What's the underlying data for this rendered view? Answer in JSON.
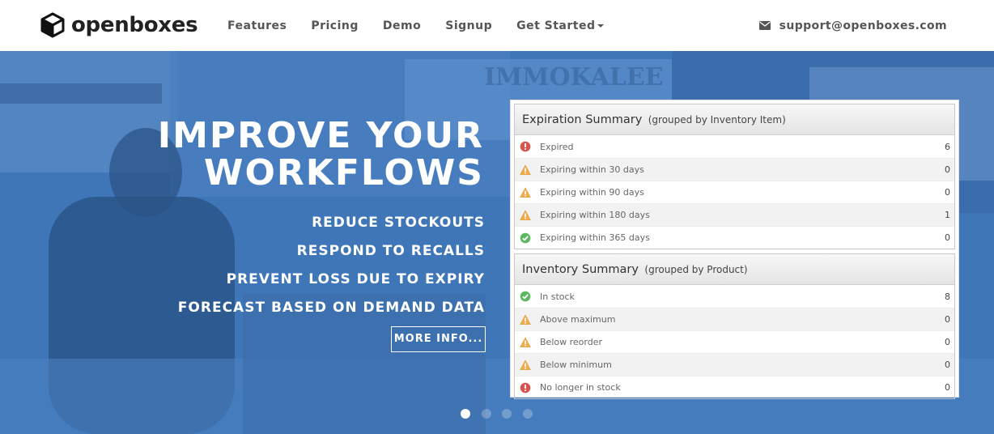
{
  "brand": {
    "name": "openboxes",
    "logo_icon": "cube-icon"
  },
  "nav": {
    "links": [
      "Features",
      "Pricing",
      "Demo",
      "Signup"
    ],
    "dropdown_label": "Get Started",
    "email": "support@openboxes.com",
    "email_icon": "envelope-icon"
  },
  "hero": {
    "headline_line1": "IMPROVE YOUR",
    "headline_line2": "WORKFLOWS",
    "bullets": [
      "REDUCE STOCKOUTS",
      "RESPOND TO RECALLS",
      "PREVENT LOSS DUE TO EXPIRY",
      "FORECAST BASED ON DEMAND DATA"
    ],
    "button_label": "MORE INFO..."
  },
  "expiration_summary": {
    "title": "Expiration Summary",
    "subtitle": "(grouped by Inventory Item)",
    "rows": [
      {
        "label": "Expired",
        "value": "6",
        "status": "error"
      },
      {
        "label": "Expiring within 30 days",
        "value": "0",
        "status": "warning"
      },
      {
        "label": "Expiring within 90 days",
        "value": "0",
        "status": "warning"
      },
      {
        "label": "Expiring within 180 days",
        "value": "1",
        "status": "warning"
      },
      {
        "label": "Expiring within 365 days",
        "value": "0",
        "status": "ok"
      }
    ]
  },
  "inventory_summary": {
    "title": "Inventory Summary",
    "subtitle": "(grouped by Product)",
    "rows": [
      {
        "label": "In stock",
        "value": "8",
        "status": "ok"
      },
      {
        "label": "Above maximum",
        "value": "0",
        "status": "warning"
      },
      {
        "label": "Below reorder",
        "value": "0",
        "status": "warning"
      },
      {
        "label": "Below minimum",
        "value": "0",
        "status": "warning"
      },
      {
        "label": "No longer in stock",
        "value": "0",
        "status": "error"
      }
    ]
  },
  "carousel": {
    "slide_count": 4,
    "active_index": 0
  },
  "colors": {
    "hero_blue": "#3e76b8",
    "error": "#d9534f",
    "warning": "#f0ad4e",
    "ok": "#5cb85c"
  }
}
